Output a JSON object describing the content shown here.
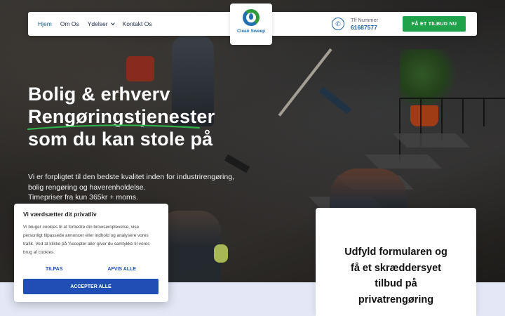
{
  "nav": {
    "links": [
      {
        "label": "Hjem",
        "active": true
      },
      {
        "label": "Om Os"
      },
      {
        "label": "Ydelser",
        "dropdown": true
      },
      {
        "label": "Kontakt Os"
      }
    ],
    "logo_text": "Clean Sweep",
    "phone_label": "Tlf Nummer",
    "phone_number": "61687577",
    "cta_label": "FÅ ET TILBUD NU"
  },
  "hero": {
    "title_line1": "Bolig & erhverv",
    "title_line2": "Rengøringstjenester",
    "title_line3": "som du kan stole på",
    "desc_line1": "Vi er forpligtet til den bedste kvalitet inden for industrirengøring,",
    "desc_line2": "bolig rengøring og haverenholdelse.",
    "desc_line3": "Timepriser fra kun 365kr + moms."
  },
  "cookie": {
    "title": "Vi værdsætter dit privatliv",
    "text": "Vi bruger cookies til at forbedre din browseroplevelse, vise personligt tilpassede annoncer eller indhold og analysere vores trafik. Ved at klikke på 'Accepter alle' giver du samtykke til vores brug af cookies.",
    "customize_label": "TILPAS",
    "reject_label": "AFVIS ALLE",
    "accept_label": "ACCEPTER ALLE"
  },
  "form_card": {
    "line1": "Udfyld formularen og",
    "line2": "få et skræddersyet",
    "line3": "tilbud på",
    "line4": "privatrengøring"
  },
  "colors": {
    "brand_blue": "#1f5fa8",
    "cta_green": "#1fa24a",
    "accent_underline": "#2fb24a",
    "cookie_blue": "#1f4fb5"
  }
}
